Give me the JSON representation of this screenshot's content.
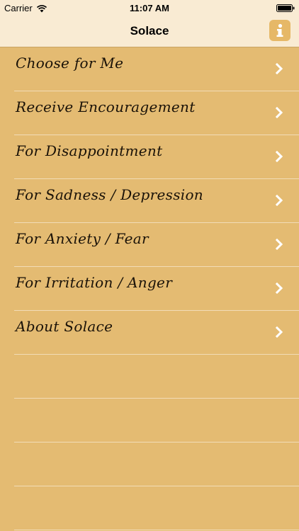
{
  "status_bar": {
    "carrier": "Carrier",
    "time": "11:07 AM"
  },
  "nav": {
    "title": "Solace",
    "info_icon": "info-icon"
  },
  "colors": {
    "background": "#e4bb72",
    "header": "#f9ebd3",
    "info_button": "#e6b867",
    "separator": "#f2dcb7"
  },
  "menu": {
    "items": [
      {
        "label": "Choose for Me",
        "icon": "chevron-right-icon"
      },
      {
        "label": "Receive Encouragement",
        "icon": "chevron-right-icon"
      },
      {
        "label": "For Disappointment",
        "icon": "chevron-right-icon"
      },
      {
        "label": "For Sadness / Depression",
        "icon": "chevron-right-icon"
      },
      {
        "label": "For Anxiety / Fear",
        "icon": "chevron-right-icon"
      },
      {
        "label": "For Irritation / Anger",
        "icon": "chevron-right-icon"
      },
      {
        "label": "About Solace",
        "icon": "chevron-right-icon"
      }
    ]
  }
}
